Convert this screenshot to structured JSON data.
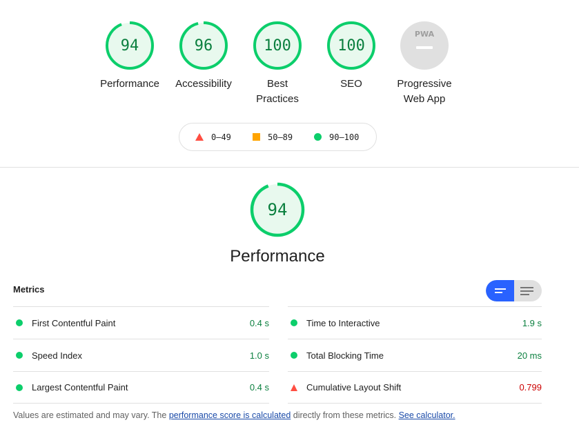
{
  "categories": [
    {
      "score": "94",
      "label_lines": [
        "Performance"
      ],
      "status": "pass"
    },
    {
      "score": "96",
      "label_lines": [
        "Accessibility"
      ],
      "status": "pass"
    },
    {
      "score": "100",
      "label_lines": [
        "Best",
        "Practices"
      ],
      "status": "pass"
    },
    {
      "score": "100",
      "label_lines": [
        "SEO"
      ],
      "status": "pass"
    },
    {
      "score": "",
      "icon_text": "PWA",
      "label_lines": [
        "Progressive",
        "Web App"
      ],
      "status": "na"
    }
  ],
  "legend": {
    "fail": "0–49",
    "average": "50–89",
    "pass": "90–100"
  },
  "performance": {
    "score": "94",
    "title": "Performance"
  },
  "metrics": {
    "title": "Metrics",
    "left": [
      {
        "name": "First Contentful Paint",
        "value": "0.4 s",
        "status": "pass"
      },
      {
        "name": "Speed Index",
        "value": "1.0 s",
        "status": "pass"
      },
      {
        "name": "Largest Contentful Paint",
        "value": "0.4 s",
        "status": "pass"
      }
    ],
    "right": [
      {
        "name": "Time to Interactive",
        "value": "1.9 s",
        "status": "pass"
      },
      {
        "name": "Total Blocking Time",
        "value": "20 ms",
        "status": "pass"
      },
      {
        "name": "Cumulative Layout Shift",
        "value": "0.799",
        "status": "fail"
      }
    ]
  },
  "footnote": {
    "prefix": "Values are estimated and may vary. The ",
    "link1": "performance score is calculated",
    "middle": " directly from these metrics. ",
    "link2": "See calculator."
  },
  "colors": {
    "pass": "#0cce6b",
    "pass_fill": "#e8f9ee",
    "pass_text": "#0a7f3e",
    "average": "#ffa400",
    "fail": "#ff4e42",
    "fail_text": "#cc0000",
    "na": "#e0e0e0",
    "toggle_active": "#2962ff"
  }
}
